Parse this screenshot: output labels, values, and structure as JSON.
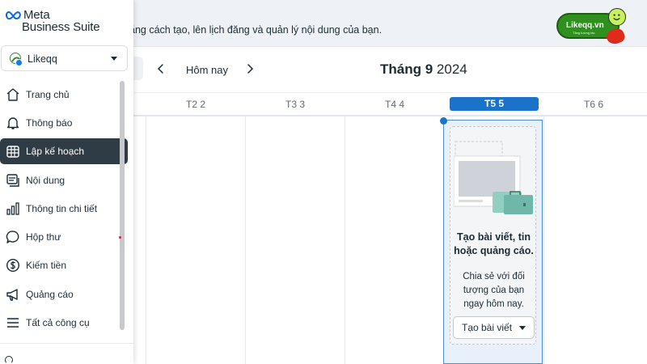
{
  "banner": {
    "text": "ằng cách tạo, lên lịch đăng và quản lý nội dung của bạn.",
    "watermark": {
      "text": "Likeqq.vn",
      "subtext": "Tăng tương tác"
    }
  },
  "sidebar": {
    "logo": {
      "line1": "Meta",
      "line2": "Business Suite"
    },
    "account": {
      "name": "Likeqq"
    },
    "items": [
      {
        "label": "Trang chủ",
        "icon": "home-icon"
      },
      {
        "label": "Thông báo",
        "icon": "bell-icon"
      },
      {
        "label": "Lập kế hoạch",
        "icon": "calendar-grid-icon"
      },
      {
        "label": "Nội dung",
        "icon": "content-icon"
      },
      {
        "label": "Thông tin chi tiết",
        "icon": "bar-chart-icon"
      },
      {
        "label": "Hộp thư",
        "icon": "chat-icon"
      },
      {
        "label": "Kiếm tiền",
        "icon": "dollar-icon"
      },
      {
        "label": "Quảng cáo",
        "icon": "megaphone-icon"
      },
      {
        "label": "Tất cả công cụ",
        "icon": "menu-icon"
      }
    ],
    "active_item": "Lập kế hoạch"
  },
  "calendar": {
    "today_label": "Hôm nay",
    "month": "Tháng 9",
    "year": "2024",
    "days": [
      "T2 2",
      "T3 3",
      "T4 4",
      "T5 5",
      "T6 6"
    ],
    "active_day": "T5 5"
  },
  "promo": {
    "title": "Tạo bài viết, tin hoặc quảng cáo.",
    "description": "Chia sẻ với đối tượng của bạn ngay hôm nay.",
    "button_label": "Tạo bài viết"
  },
  "colors": {
    "accent": "#1a73c8",
    "sidebar_active": "#2f3b45",
    "watermark_green": "#2f8f1f"
  }
}
